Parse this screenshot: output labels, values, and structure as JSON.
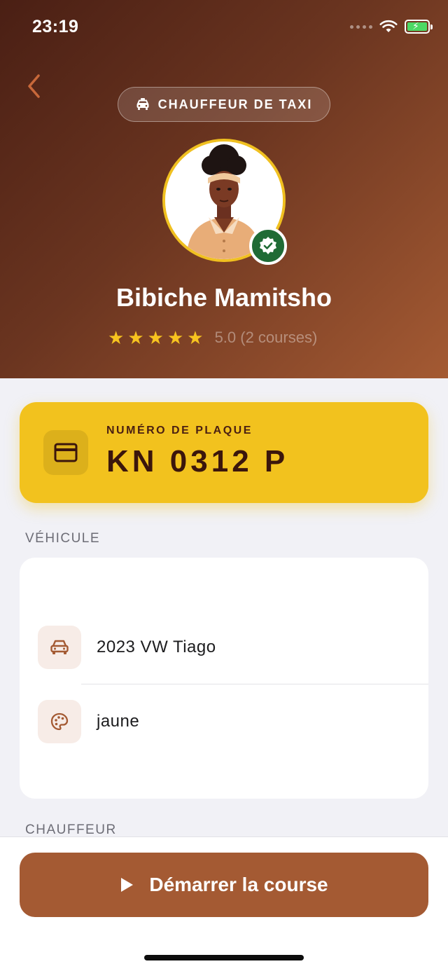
{
  "status_bar": {
    "time": "23:19"
  },
  "header": {
    "role_label": "CHAUFFEUR DE TAXI",
    "driver_name": "Bibiche Mamitsho",
    "rating_stars": 5,
    "rating_text": "5.0 (2 courses)"
  },
  "plate": {
    "label": "NUMÉRO DE PLAQUE",
    "number": "KN 0312 P"
  },
  "vehicle_section": {
    "title": "VÉHICULE",
    "items": [
      {
        "icon": "car-icon",
        "text": "2023 VW Tiago"
      },
      {
        "icon": "palette-icon",
        "text": "jaune"
      }
    ]
  },
  "driver_section": {
    "title": "CHAUFFEUR"
  },
  "action": {
    "start_label": "Démarrer la course"
  },
  "colors": {
    "brand_brown": "#a45a33",
    "plate_yellow": "#f2c21e",
    "verified_green": "#1f6b35",
    "star_gold": "#f7c31f"
  }
}
